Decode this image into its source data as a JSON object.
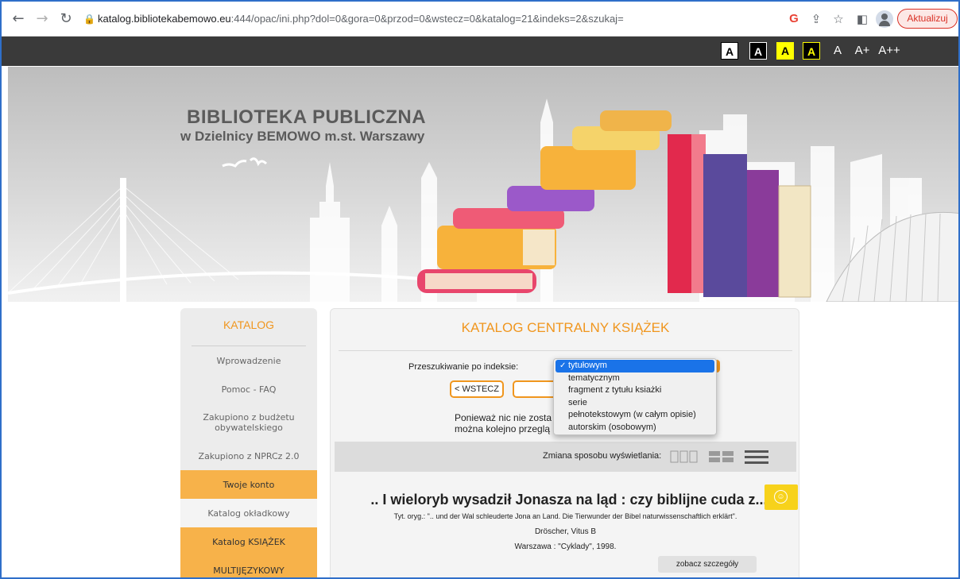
{
  "browser": {
    "url_host": "katalog.bibliotekabemowo.eu",
    "url_rest": ":444/opac/ini.php?dol=0&gora=0&przod=0&wstecz=0&katalog=21&indeks=2&szukaj=",
    "update_label": "Aktualizuj",
    "icons": [
      "back-icon",
      "forward-icon",
      "reload-icon",
      "lock-icon",
      "google-icon",
      "share-icon",
      "bookmark-star-icon",
      "sidepanel-icon",
      "profile-icon",
      "kebab-menu-icon"
    ]
  },
  "a11y": {
    "contrast_white": "A",
    "contrast_black": "A",
    "contrast_yellow": "A",
    "contrast_black_yellow": "A",
    "font_normal": "A",
    "font_bigger": "A+",
    "font_biggest": "A++"
  },
  "banner": {
    "title": "BIBLIOTEKA PUBLICZNA",
    "subtitle": "w Dzielnicy BEMOWO m.st. Warszawy"
  },
  "sidebar": {
    "header": "KATALOG",
    "items": [
      {
        "label": "Wprowadzenie"
      },
      {
        "label": "Pomoc - FAQ"
      },
      {
        "label": "Zakupiono z budżetu obywatelskiego"
      },
      {
        "label": "Zakupiono z NPRCz 2.0"
      },
      {
        "label": "Twoje konto"
      },
      {
        "label": "Katalog okładkowy"
      },
      {
        "label": "Katalog KSIĄŻEK"
      },
      {
        "label": "MULTIJĘZYKOWY"
      }
    ]
  },
  "main": {
    "title": "KATALOG CENTRALNY KSIĄŻEK",
    "index_label": "Przeszukiwanie po indeksie:",
    "back_button": "< WSTECZ",
    "info_line1": "Ponieważ nic nie zosta",
    "info_line2": "można kolejno przeglą",
    "view_label": "Zmiana sposobu wyświetlania:",
    "dropdown_options": [
      {
        "label": "tytułowym",
        "selected": true
      },
      {
        "label": "tematycznym",
        "selected": false
      },
      {
        "label": "fragment z tytułu ksiażki",
        "selected": false
      },
      {
        "label": "serie",
        "selected": false
      },
      {
        "label": "pełnotekstowym (w całym opisie)",
        "selected": false
      },
      {
        "label": "autorskim (osobowym)",
        "selected": false
      }
    ]
  },
  "result": {
    "title": ".. I wieloryb wysadził Jonasza na ląd : czy biblijne cuda z...",
    "original_title": "Tyt. oryg.: \".. und der Wal schleuderte Jona an Land. Die Tierwunder der Bibel naturwissenschaftlich erklärt\".",
    "author": "Dröscher, Vitus B",
    "publication": "Warszawa : \"Cyklady\", 1998.",
    "details_button": "zobacz szczegóły"
  },
  "colors": {
    "accent_orange": "#f0961e",
    "menu_orange": "#f7b24a",
    "selection_blue": "#1a73e8",
    "dark_bar": "#3a3a3a"
  }
}
